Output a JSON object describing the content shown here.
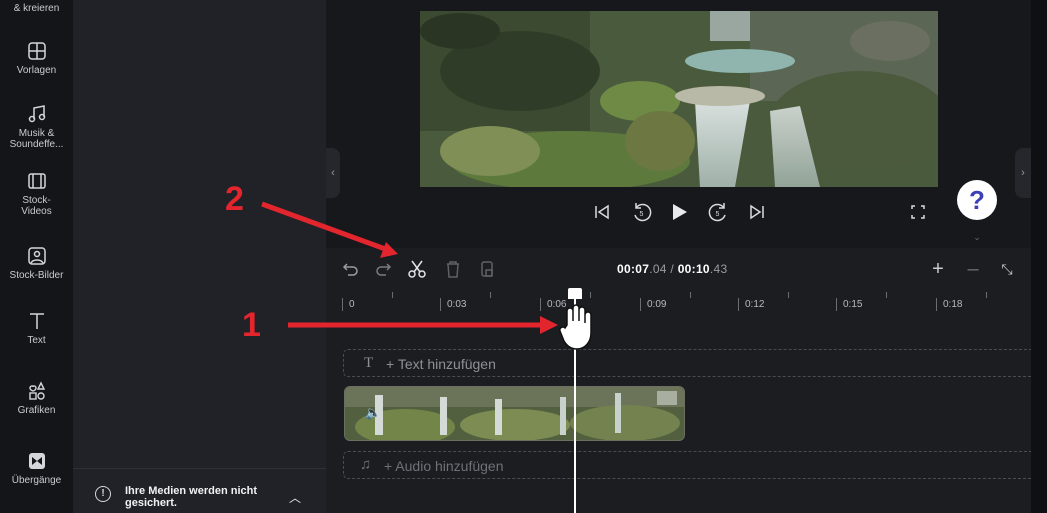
{
  "nav": {
    "top_partial": "& kreieren",
    "items": [
      {
        "id": "vorlagen",
        "label": "Vorlagen",
        "icon": "templates-icon"
      },
      {
        "id": "musik",
        "label": "Musik & Soundeffe...",
        "icon": "music-note-icon"
      },
      {
        "id": "stock-videos",
        "label": "Stock-Videos",
        "icon": "film-strip-icon"
      },
      {
        "id": "stock-bilder",
        "label": "Stock-Bilder",
        "icon": "image-icon"
      },
      {
        "id": "text",
        "label": "Text",
        "icon": "text-t-icon"
      },
      {
        "id": "grafiken",
        "label": "Grafiken",
        "icon": "shapes-icon"
      },
      {
        "id": "uebergaenge",
        "label": "Übergänge",
        "icon": "transition-icon"
      }
    ]
  },
  "media_panel": {
    "top_text": "",
    "notice": "Ihre Medien werden nicht gesichert."
  },
  "player": {
    "help_label": "?",
    "controls": [
      "skip-start-icon",
      "rewind-5-icon",
      "play-icon",
      "forward-5-icon",
      "skip-end-icon",
      "fullscreen-icon"
    ]
  },
  "timeline": {
    "current_time": "00:07",
    "current_frac": ".04",
    "separator": " / ",
    "total_time": "00:10",
    "total_frac": ".43",
    "ruler_labels": [
      "0",
      "0:03",
      "0:06",
      "0:09",
      "0:12",
      "0:15",
      "0:18"
    ],
    "text_track_label": "+ Text hinzufügen",
    "audio_track_label": "+ Audio hinzufügen",
    "zoom_in": "+",
    "zoom_out": "–"
  },
  "annotations": {
    "marker_1": "1",
    "marker_2": "2",
    "color": "#e3252e"
  }
}
